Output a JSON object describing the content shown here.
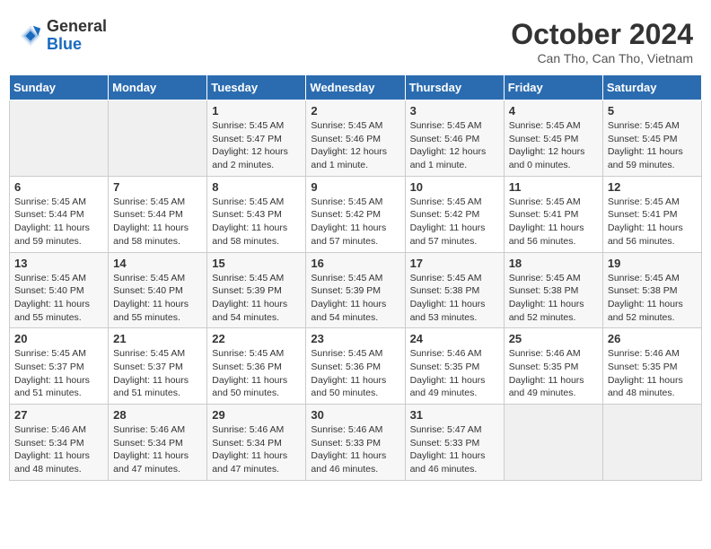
{
  "header": {
    "logo_general": "General",
    "logo_blue": "Blue",
    "title": "October 2024",
    "subtitle": "Can Tho, Can Tho, Vietnam"
  },
  "days_of_week": [
    "Sunday",
    "Monday",
    "Tuesday",
    "Wednesday",
    "Thursday",
    "Friday",
    "Saturday"
  ],
  "weeks": [
    [
      {
        "day": null,
        "content": null
      },
      {
        "day": null,
        "content": null
      },
      {
        "day": "1",
        "content": "Sunrise: 5:45 AM\nSunset: 5:47 PM\nDaylight: 12 hours\nand 2 minutes."
      },
      {
        "day": "2",
        "content": "Sunrise: 5:45 AM\nSunset: 5:46 PM\nDaylight: 12 hours\nand 1 minute."
      },
      {
        "day": "3",
        "content": "Sunrise: 5:45 AM\nSunset: 5:46 PM\nDaylight: 12 hours\nand 1 minute."
      },
      {
        "day": "4",
        "content": "Sunrise: 5:45 AM\nSunset: 5:45 PM\nDaylight: 12 hours\nand 0 minutes."
      },
      {
        "day": "5",
        "content": "Sunrise: 5:45 AM\nSunset: 5:45 PM\nDaylight: 11 hours\nand 59 minutes."
      }
    ],
    [
      {
        "day": "6",
        "content": "Sunrise: 5:45 AM\nSunset: 5:44 PM\nDaylight: 11 hours\nand 59 minutes."
      },
      {
        "day": "7",
        "content": "Sunrise: 5:45 AM\nSunset: 5:44 PM\nDaylight: 11 hours\nand 58 minutes."
      },
      {
        "day": "8",
        "content": "Sunrise: 5:45 AM\nSunset: 5:43 PM\nDaylight: 11 hours\nand 58 minutes."
      },
      {
        "day": "9",
        "content": "Sunrise: 5:45 AM\nSunset: 5:42 PM\nDaylight: 11 hours\nand 57 minutes."
      },
      {
        "day": "10",
        "content": "Sunrise: 5:45 AM\nSunset: 5:42 PM\nDaylight: 11 hours\nand 57 minutes."
      },
      {
        "day": "11",
        "content": "Sunrise: 5:45 AM\nSunset: 5:41 PM\nDaylight: 11 hours\nand 56 minutes."
      },
      {
        "day": "12",
        "content": "Sunrise: 5:45 AM\nSunset: 5:41 PM\nDaylight: 11 hours\nand 56 minutes."
      }
    ],
    [
      {
        "day": "13",
        "content": "Sunrise: 5:45 AM\nSunset: 5:40 PM\nDaylight: 11 hours\nand 55 minutes."
      },
      {
        "day": "14",
        "content": "Sunrise: 5:45 AM\nSunset: 5:40 PM\nDaylight: 11 hours\nand 55 minutes."
      },
      {
        "day": "15",
        "content": "Sunrise: 5:45 AM\nSunset: 5:39 PM\nDaylight: 11 hours\nand 54 minutes."
      },
      {
        "day": "16",
        "content": "Sunrise: 5:45 AM\nSunset: 5:39 PM\nDaylight: 11 hours\nand 54 minutes."
      },
      {
        "day": "17",
        "content": "Sunrise: 5:45 AM\nSunset: 5:38 PM\nDaylight: 11 hours\nand 53 minutes."
      },
      {
        "day": "18",
        "content": "Sunrise: 5:45 AM\nSunset: 5:38 PM\nDaylight: 11 hours\nand 52 minutes."
      },
      {
        "day": "19",
        "content": "Sunrise: 5:45 AM\nSunset: 5:38 PM\nDaylight: 11 hours\nand 52 minutes."
      }
    ],
    [
      {
        "day": "20",
        "content": "Sunrise: 5:45 AM\nSunset: 5:37 PM\nDaylight: 11 hours\nand 51 minutes."
      },
      {
        "day": "21",
        "content": "Sunrise: 5:45 AM\nSunset: 5:37 PM\nDaylight: 11 hours\nand 51 minutes."
      },
      {
        "day": "22",
        "content": "Sunrise: 5:45 AM\nSunset: 5:36 PM\nDaylight: 11 hours\nand 50 minutes."
      },
      {
        "day": "23",
        "content": "Sunrise: 5:45 AM\nSunset: 5:36 PM\nDaylight: 11 hours\nand 50 minutes."
      },
      {
        "day": "24",
        "content": "Sunrise: 5:46 AM\nSunset: 5:35 PM\nDaylight: 11 hours\nand 49 minutes."
      },
      {
        "day": "25",
        "content": "Sunrise: 5:46 AM\nSunset: 5:35 PM\nDaylight: 11 hours\nand 49 minutes."
      },
      {
        "day": "26",
        "content": "Sunrise: 5:46 AM\nSunset: 5:35 PM\nDaylight: 11 hours\nand 48 minutes."
      }
    ],
    [
      {
        "day": "27",
        "content": "Sunrise: 5:46 AM\nSunset: 5:34 PM\nDaylight: 11 hours\nand 48 minutes."
      },
      {
        "day": "28",
        "content": "Sunrise: 5:46 AM\nSunset: 5:34 PM\nDaylight: 11 hours\nand 47 minutes."
      },
      {
        "day": "29",
        "content": "Sunrise: 5:46 AM\nSunset: 5:34 PM\nDaylight: 11 hours\nand 47 minutes."
      },
      {
        "day": "30",
        "content": "Sunrise: 5:46 AM\nSunset: 5:33 PM\nDaylight: 11 hours\nand 46 minutes."
      },
      {
        "day": "31",
        "content": "Sunrise: 5:47 AM\nSunset: 5:33 PM\nDaylight: 11 hours\nand 46 minutes."
      },
      {
        "day": null,
        "content": null
      },
      {
        "day": null,
        "content": null
      }
    ]
  ]
}
